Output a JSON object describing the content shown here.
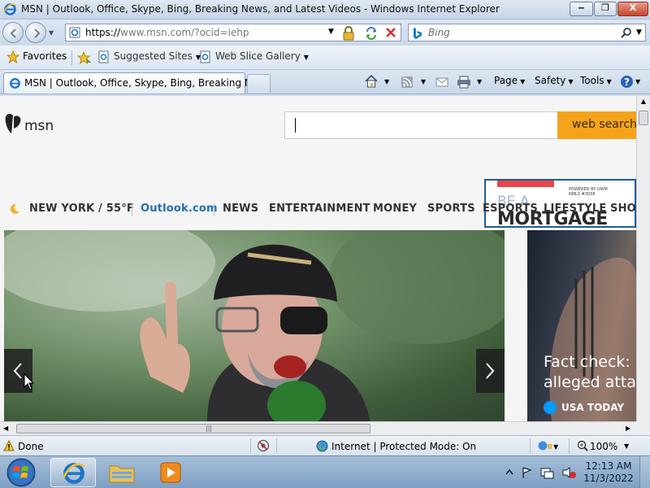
{
  "window": {
    "title": "MSN | Outlook, Office, Skype, Bing, Breaking News, and Latest Videos - Windows Internet Explorer",
    "min_glyph": "‒",
    "max_glyph": "❐",
    "close_glyph": "X"
  },
  "address_bar": {
    "url_scheme": "https://",
    "url_rest": "www.msn.com/?ocid=iehp"
  },
  "search_box": {
    "placeholder": "Bing"
  },
  "favorites_bar": {
    "favorites_label": "Favorites",
    "suggested_sites_label": "Suggested Sites",
    "web_slice_label": "Web Slice Gallery"
  },
  "tab": {
    "title": "MSN | Outlook, Office, Skype, Bing, Breaking Ne..."
  },
  "command_bar": {
    "page_label": "Page",
    "safety_label": "Safety",
    "tools_label": "Tools"
  },
  "msn": {
    "logo_text": "msn",
    "search_button": "web search",
    "nav": {
      "weather": "NEW YORK / 55°F",
      "outlook": "Outlook.com",
      "news": "NEWS",
      "entertainment": "ENTERTAINMENT",
      "money": "MONEY",
      "sports": "SPORTS",
      "esports": "ESPORTS",
      "lifestyle": "LIFESTYLE",
      "shopping": "SHO"
    },
    "ad": {
      "powered_by": "POWERED BY UWM",
      "nmls": "NMLS #3038",
      "line1": "BE A",
      "line2": "MORTGAGE"
    },
    "card": {
      "headline_line1": "Fact check: P",
      "headline_line2": "alleged attac",
      "source": "USA TODAY"
    }
  },
  "status_bar": {
    "status": "Done",
    "zone": "Internet | Protected Mode: On",
    "zoom": "100%"
  },
  "taskbar": {
    "time": "12:13 AM",
    "date": "11/3/2022"
  },
  "colors": {
    "msn_orange": "#f6a31c",
    "outlook_blue": "#1f6fb3",
    "ad_blue": "#1e5d95",
    "ad_red": "#e8464a"
  }
}
